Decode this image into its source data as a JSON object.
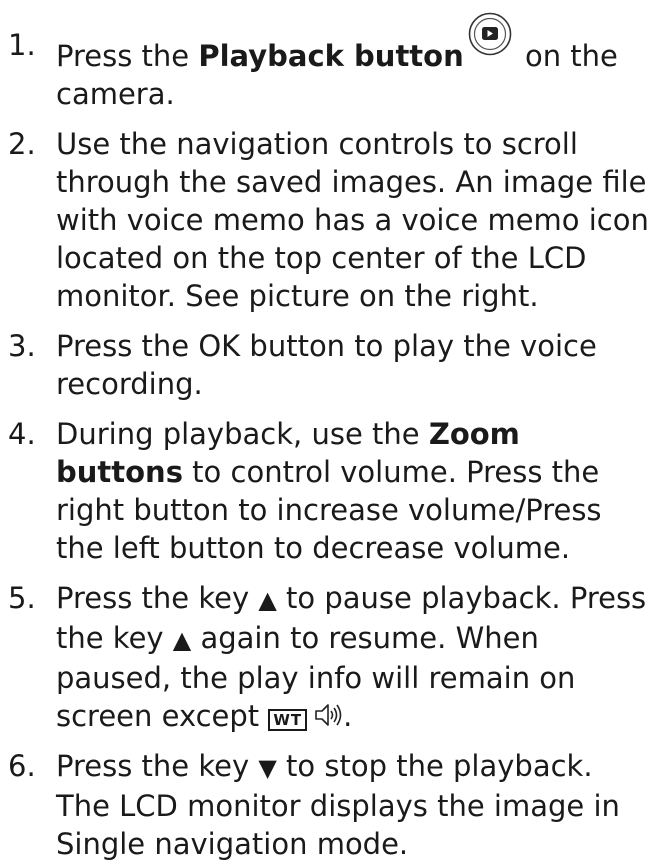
{
  "steps": [
    {
      "num": "1.",
      "t1": "Press the ",
      "b1": "Playback button",
      "icon": "playback-button-icon",
      "t2": " on the camera."
    },
    {
      "num": "2.",
      "text": "Use the navigation controls to scroll through the saved images. An image file with voice memo has a voice memo icon located on the top center of the LCD monitor. See picture on the right."
    },
    {
      "num": "3.",
      "text": "Press the OK button to play the voice recording."
    },
    {
      "num": "4.",
      "t1": "During playback, use the ",
      "b1": "Zoom buttons",
      "t2": " to control volume. Press the right button to increase volume/Press the left button to decrease volume."
    },
    {
      "num": "5.",
      "t1": "Press the key ",
      "tri1": "▲",
      "t2": " to pause playback. Press the key ",
      "tri2": "▲",
      "t3": " again to resume. When paused, the play info will remain on screen except ",
      "wt": "WT",
      "icon": "speaker-volume-icon",
      "t4": "."
    },
    {
      "num": "6.",
      "t1": "Press the key ",
      "tri1": "▼",
      "t2": " to stop the playback. The LCD monitor displays the image in Single navigation mode."
    }
  ]
}
